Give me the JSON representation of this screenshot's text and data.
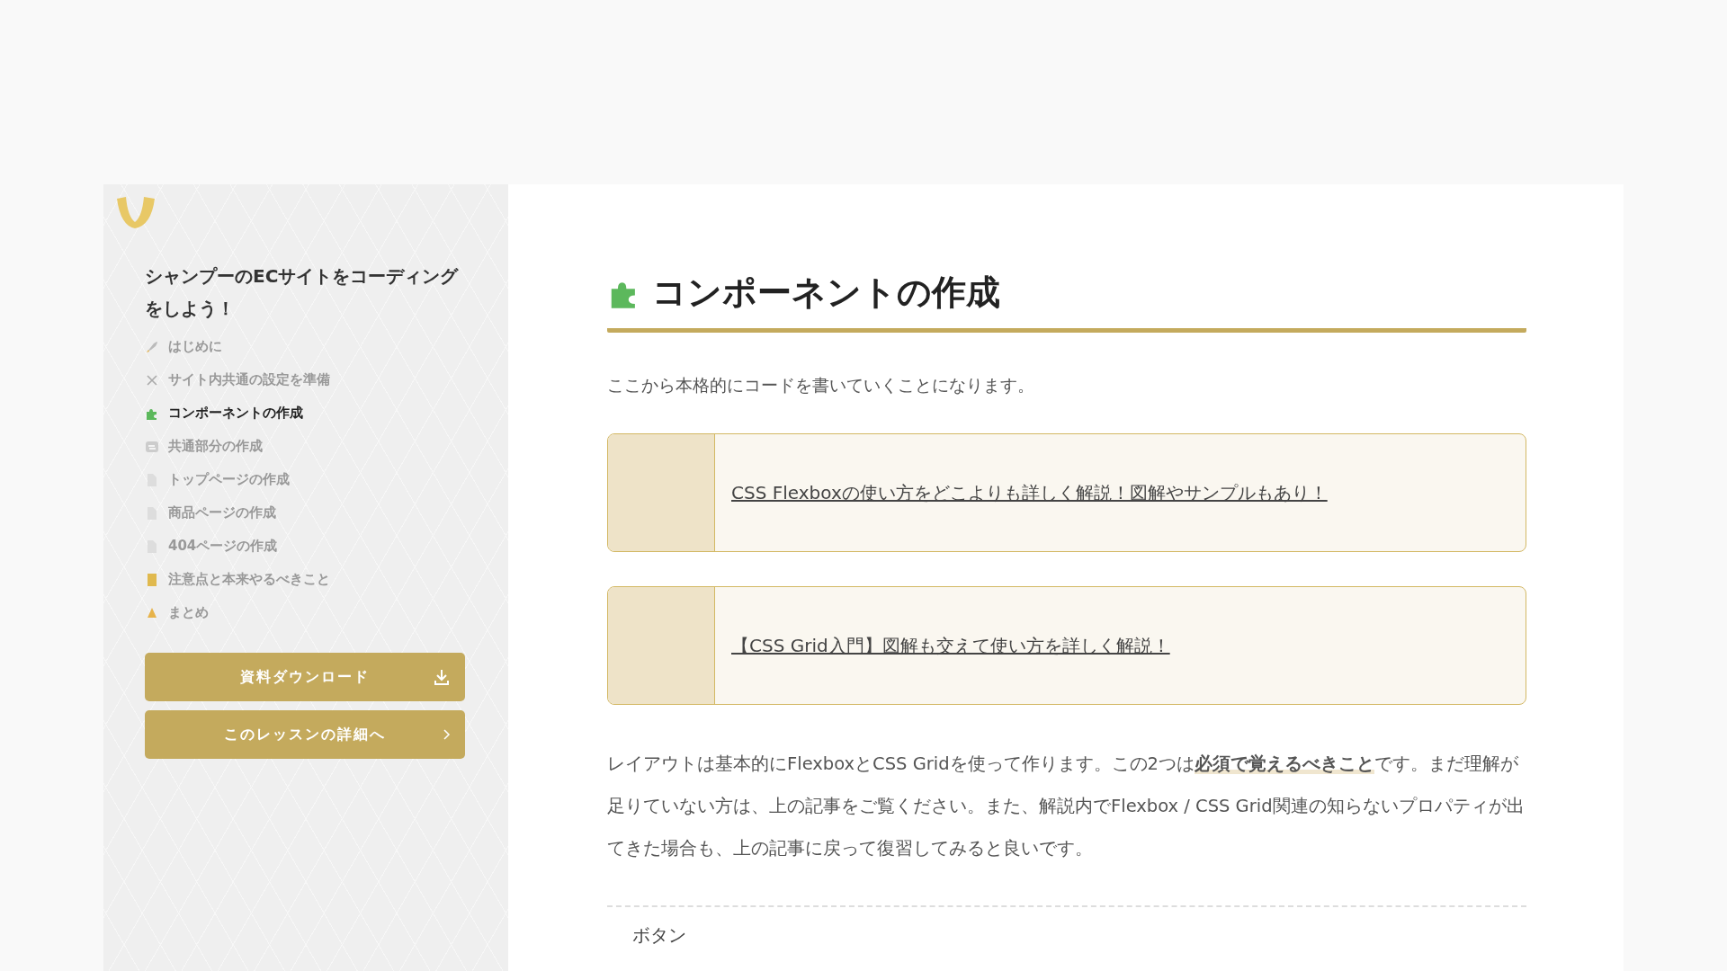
{
  "sidebar": {
    "course_title": "シャンプーのECサイトをコーディングをしよう！",
    "items": [
      {
        "label": "はじめに",
        "selected": false
      },
      {
        "label": "サイト内共通の設定を準備",
        "selected": false
      },
      {
        "label": "コンポーネントの作成",
        "selected": true
      },
      {
        "label": "共通部分の作成",
        "selected": false
      },
      {
        "label": "トップページの作成",
        "selected": false
      },
      {
        "label": "商品ページの作成",
        "selected": false
      },
      {
        "label": "404ページの作成",
        "selected": false
      },
      {
        "label": "注意点と本来やるべきこと",
        "selected": false
      },
      {
        "label": "まとめ",
        "selected": false
      }
    ],
    "buttons": [
      {
        "label": "資料ダウンロード",
        "kind": "download"
      },
      {
        "label": "このレッスンの詳細へ",
        "kind": "next"
      }
    ]
  },
  "article": {
    "title": "コンポーネントの作成",
    "intro": "ここから本格的にコードを書いていくことになります。",
    "link_cards": [
      {
        "label": "CSS Flexboxの使い方をどこよりも詳しく解説！図解やサンプルもあり！"
      },
      {
        "label": "【CSS Grid入門】図解も交えて使い方を詳しく解説！"
      }
    ],
    "body": "レイアウトは基本的にFlexboxとCSS Gridを使って作ります。この2つは**必須で覚えるべきこと**です。まだ理解が足りていない方は、上の記事をご覧ください。また、解説内でFlexbox / CSS Grid関連の知らないプロパティが出てきた場合も、上の記事に戻って復習してみると良いです。",
    "next_heading": "ボタン"
  }
}
